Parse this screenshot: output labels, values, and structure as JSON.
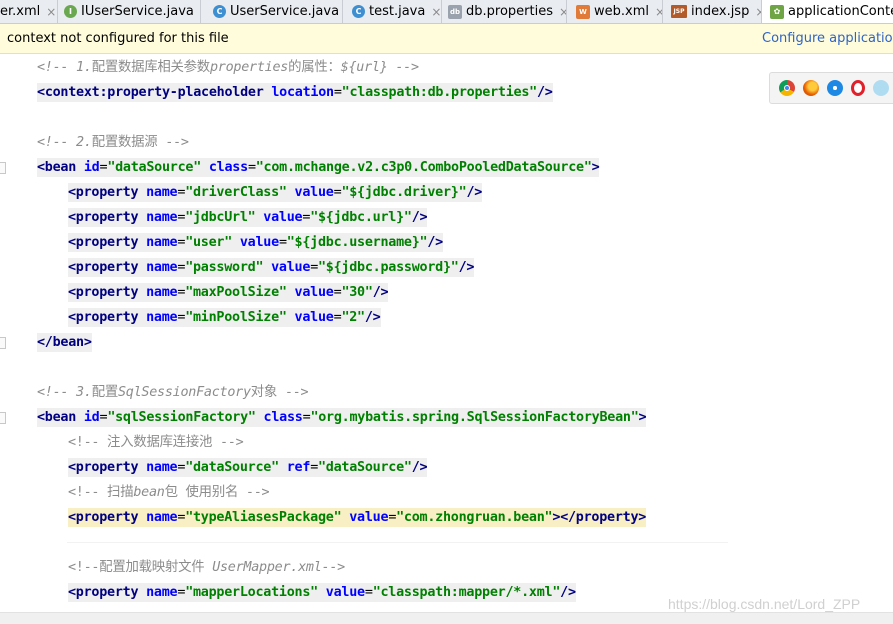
{
  "tabs": [
    {
      "label": "er.xml",
      "icon": "xml-file-icon"
    },
    {
      "label": "IUserService.java",
      "icon": "interface-file-icon"
    },
    {
      "label": "UserService.java",
      "icon": "class-file-icon"
    },
    {
      "label": "test.java",
      "icon": "class-file-icon"
    },
    {
      "label": "db.properties",
      "icon": "properties-file-icon"
    },
    {
      "label": "web.xml",
      "icon": "xml-file-icon"
    },
    {
      "label": "index.jsp",
      "icon": "jsp-file-icon"
    },
    {
      "label": "applicationContext",
      "icon": "spring-xml-file-icon"
    }
  ],
  "tab_close_glyph": "×",
  "notice": {
    "text": "context not configured for this file",
    "link": "Configure application c"
  },
  "code": {
    "c1_a": "<!-- 1.",
    "c1_b": "配置数据库相关参数",
    "c1_c": "properties",
    "c1_d": "的属性：",
    "c1_e": "${url} -->",
    "l2_open": "<",
    "l2_tag": "context:property-placeholder",
    "l2_attr": " location",
    "l2_eq": "=",
    "l2_val": "\"classpath:db.properties\"",
    "l2_close": "/>",
    "c2_a": "<!-- 2.",
    "c2_b": "配置数据源 -->",
    "b1_tag": "<bean",
    "b1_a1": " id",
    "b1_v1": "\"dataSource\"",
    "b1_a2": " class",
    "b1_v2": "\"com.mchange.v2.c3p0.ComboPooledDataSource\"",
    "gt": ">",
    "prop_tag": "<property",
    "name_attr": " name",
    "value_attr": " value",
    "ref_attr": " ref",
    "eq": "=",
    "selfclose": "/>",
    "p1_n": "\"driverClass\"",
    "p1_v": "\"${jdbc.driver}\"",
    "p2_n": "\"jdbcUrl\"",
    "p2_v": "\"${jdbc.url}\"",
    "p3_n": "\"user\"",
    "p3_v": "\"${jdbc.username}\"",
    "p4_n": "\"password\"",
    "p4_v": "\"${jdbc.password}\"",
    "p5_n": "\"maxPoolSize\"",
    "p5_v": "\"30\"",
    "p6_n": "\"minPoolSize\"",
    "p6_v": "\"2\"",
    "bean_end": "</bean>",
    "c3_a": "<!-- 3.",
    "c3_b": "配置",
    "c3_c": "SqlSessionFactory",
    "c3_d": "对象 -->",
    "b2_v1": "\"sqlSessionFactory\"",
    "b2_v2": "\"org.mybatis.spring.SqlSessionFactoryBean\"",
    "c4": "<!-- 注入数据库连接池 -->",
    "q1_n": "\"dataSource\"",
    "q1_r": "\"dataSource\"",
    "c5_a": "<!-- 扫描",
    "c5_b": "bean",
    "c5_c": "包 使用别名 -->",
    "q2_n": "\"typeAliasesPackage\"",
    "q2_v": "\"com.zhongruan.bean\"",
    "prop_end": "</property>",
    "c6_a": "<!--配置加载映射文件 ",
    "c6_b": "UserMapper.xml-->",
    "q3_n": "\"mapperLocations\"",
    "q3_v": "\"classpath:mapper/*.xml\""
  },
  "browsers": [
    "chrome-icon",
    "firefox-icon",
    "safari-icon",
    "opera-icon",
    "ie-icon"
  ],
  "watermark": "https://blog.csdn.net/Lord_ZPP"
}
